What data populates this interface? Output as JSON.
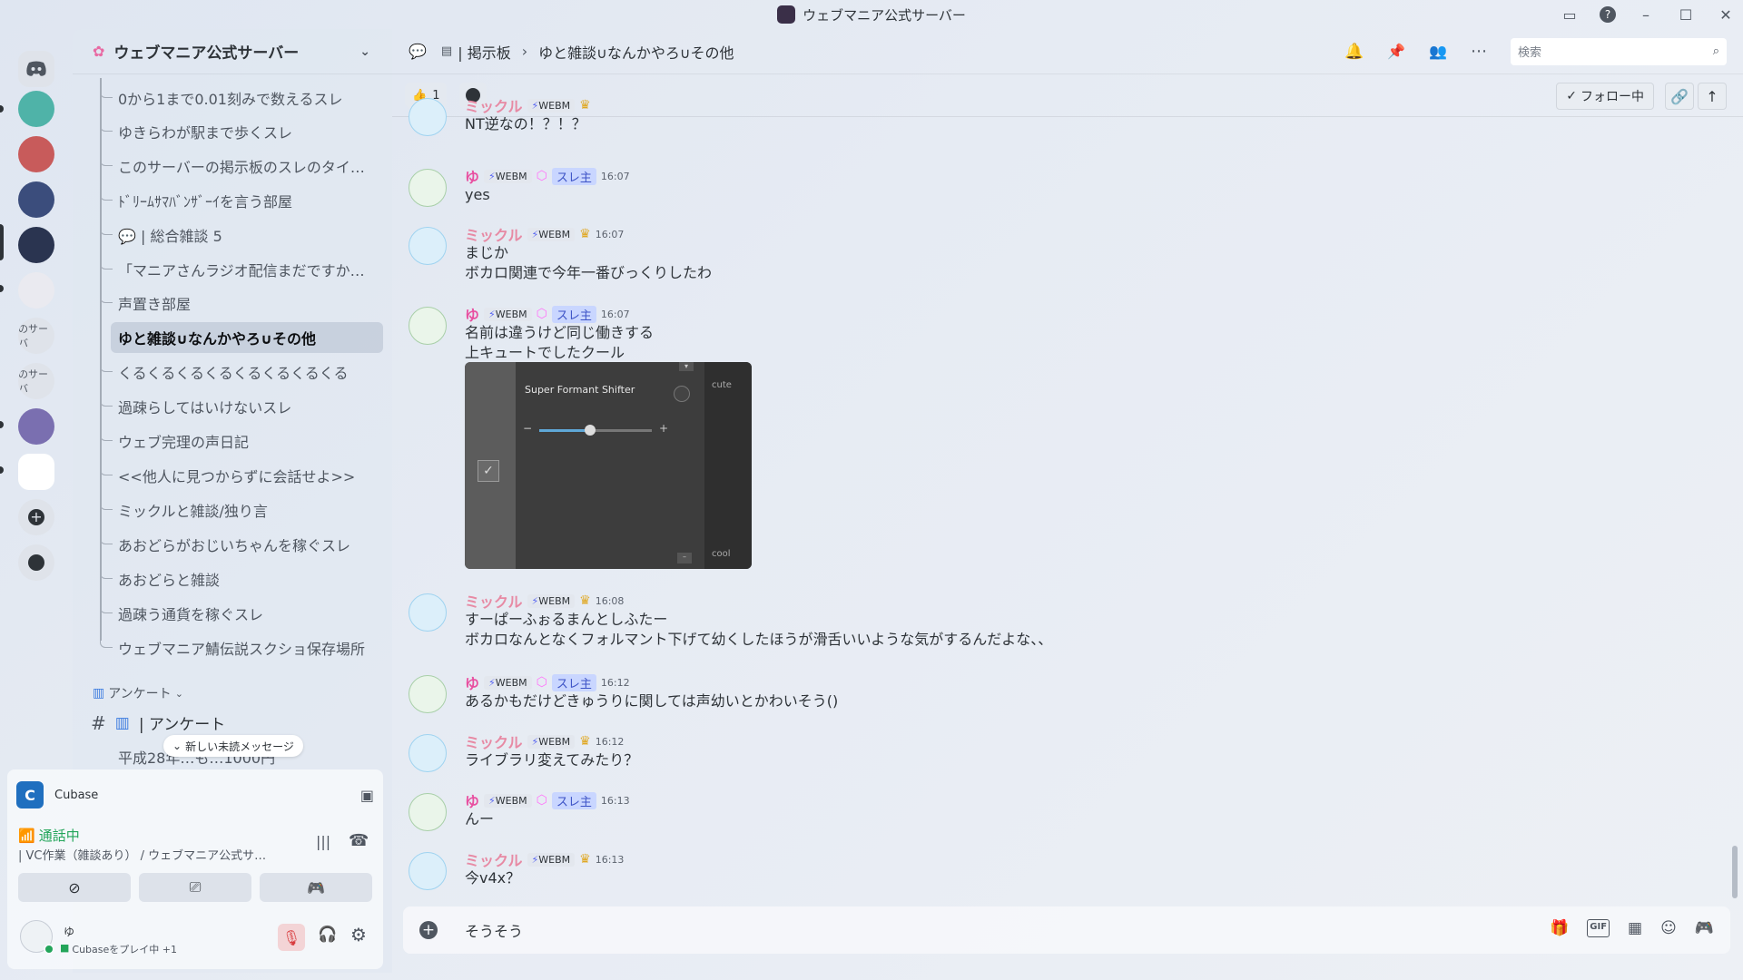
{
  "window": {
    "title": "ウェブマニア公式サーバー"
  },
  "server": {
    "name": "ウェブマニア公式サーバー"
  },
  "rail": {
    "labels": [
      "のサーバ",
      "のサーバ"
    ]
  },
  "threads": [
    "0から1まで0.01刻みで数えるスレ",
    "ゆきらわが駅まで歩くスレ",
    "このサーバーの掲示板のスレのタイ…",
    "ﾄﾞﾘｰﾑｻﾏﾊﾞﾝｻﾞｰｲを言う部屋",
    "💬 | 総合雑談 5",
    "「マニアさんラジオ配信まだですか…",
    "声置き部屋",
    "ゆと雑談∪なんかやろ∪その他",
    "くるくるくるくるくるくるくるくる",
    "過疎らしてはいけないスレ",
    "ウェブ完理の声日記",
    "<<他人に見つからずに会話せよ>>",
    "ミックルと雑談/独り言",
    "あおどらがおじいちゃんを稼ぐスレ",
    "あおどらと雑談",
    "過疎う通貨を稼ぐスレ",
    "ウェブマニア鯖伝説スクショ保存場所"
  ],
  "selected_thread_index": 7,
  "category": {
    "name": "アンケート",
    "icon": "bar-chart-icon"
  },
  "channel_anketo": "| アンケート",
  "truncated_thread": "平成28年…も…1000円",
  "unread_pill": "新しい未読メッセージ",
  "activity": {
    "app": "Cubase"
  },
  "voice": {
    "status": "通話中",
    "channel": "| VC作業（雑談あり） / ウェブマニア公式サ…"
  },
  "user": {
    "name": "ゆ",
    "status": "Cubaseをプレイ中 +1"
  },
  "header": {
    "forum": "| 掲示板",
    "thread": "ゆと雑談∪なんかやろ∪その他",
    "search_placeholder": "検索"
  },
  "subbar": {
    "reaction_count": "1",
    "follow": "フォロー中"
  },
  "messages": [
    {
      "author": "ミックル",
      "tag": "WEBM",
      "time": "",
      "lines": [
        "NT逆なの！？！？"
      ],
      "crown": true
    },
    {
      "author": "ゆ",
      "tag": "WEBM",
      "role": "スレ主",
      "time": "16:07",
      "lines": [
        "yes"
      ]
    },
    {
      "author": "ミックル",
      "tag": "WEBM",
      "time": "16:07",
      "lines": [
        "まじか",
        "ボカロ関連で今年一番びっくりしたわ"
      ],
      "crown": true
    },
    {
      "author": "ゆ",
      "tag": "WEBM",
      "role": "スレ主",
      "time": "16:07",
      "lines": [
        "名前は違うけど同じ働きする",
        "上キュートでしたクール"
      ]
    },
    {
      "author": "ミックル",
      "tag": "WEBM",
      "time": "16:08",
      "lines": [
        "すーぱーふぉるまんとしふたー",
        "ボカロなんとなくフォルマント下げて幼くしたほうが滑舌いいような気がするんだよな、、"
      ],
      "crown": true
    },
    {
      "author": "ゆ",
      "tag": "WEBM",
      "role": "スレ主",
      "time": "16:12",
      "lines": [
        "あるかもだけどきゅうりに関しては声幼いとかわいそう()"
      ]
    },
    {
      "author": "ミックル",
      "tag": "WEBM",
      "time": "16:12",
      "lines": [
        "ライブラリ変えてみたり？"
      ],
      "crown": true
    },
    {
      "author": "ゆ",
      "tag": "WEBM",
      "role": "スレ主",
      "time": "16:13",
      "lines": [
        "んー"
      ]
    },
    {
      "author": "ミックル",
      "tag": "WEBM",
      "time": "16:13",
      "lines": [
        "今v4x？"
      ],
      "crown": true
    }
  ],
  "plugin": {
    "title": "Super Formant Shifter",
    "top_label": "cute",
    "bottom_label": "cool",
    "value_fraction": 0.45
  },
  "composer": {
    "text": "そうそう"
  },
  "colors": {
    "mikkuru": "#e78aa4",
    "yu": "#e84fa0",
    "accent": "#5865f2"
  }
}
